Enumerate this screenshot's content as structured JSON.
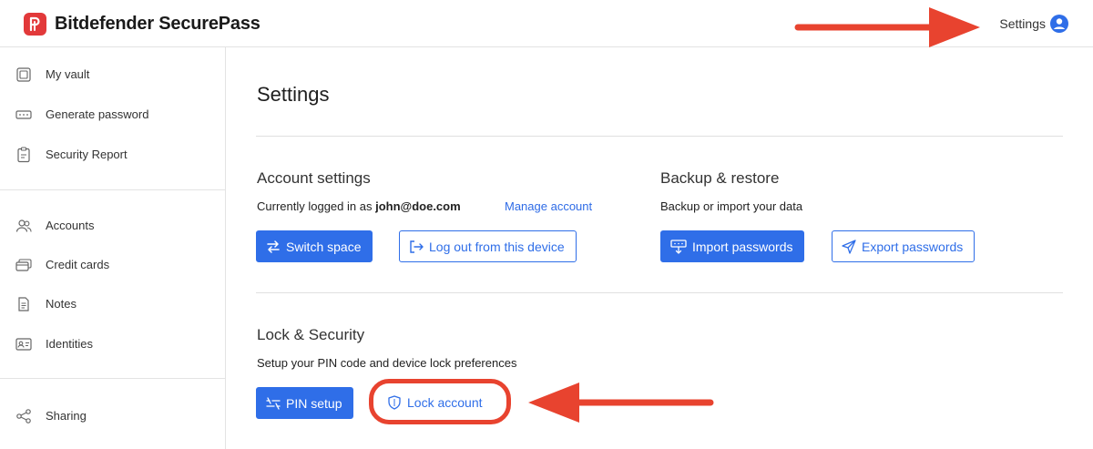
{
  "header": {
    "brand": "Bitdefender SecurePass",
    "settings_label": "Settings"
  },
  "sidebar": {
    "items": [
      {
        "label": "My vault",
        "icon": "vault-icon"
      },
      {
        "label": "Generate password",
        "icon": "password-icon"
      },
      {
        "label": "Security Report",
        "icon": "clipboard-icon"
      },
      {
        "label": "Accounts",
        "icon": "accounts-icon"
      },
      {
        "label": "Credit cards",
        "icon": "credit-card-icon"
      },
      {
        "label": "Notes",
        "icon": "notes-icon"
      },
      {
        "label": "Identities",
        "icon": "identity-icon"
      },
      {
        "label": "Sharing",
        "icon": "share-icon"
      }
    ]
  },
  "main": {
    "title": "Settings",
    "account": {
      "title": "Account settings",
      "desc_prefix": "Currently logged in as",
      "email": "john@doe.com",
      "manage_link": "Manage account",
      "switch_label": "Switch space",
      "logout_label": "Log out from this device"
    },
    "backup": {
      "title": "Backup & restore",
      "desc": "Backup or import your data",
      "import_label": "Import passwords",
      "export_label": "Export passwords"
    },
    "lock": {
      "title": "Lock & Security",
      "desc": "Setup your PIN code and device lock preferences",
      "pin_label": "PIN setup",
      "lock_label": "Lock account"
    }
  },
  "colors": {
    "brand_red": "#e2393a",
    "primary_blue": "#2f6ee8",
    "annotation_red": "#e8432f"
  }
}
